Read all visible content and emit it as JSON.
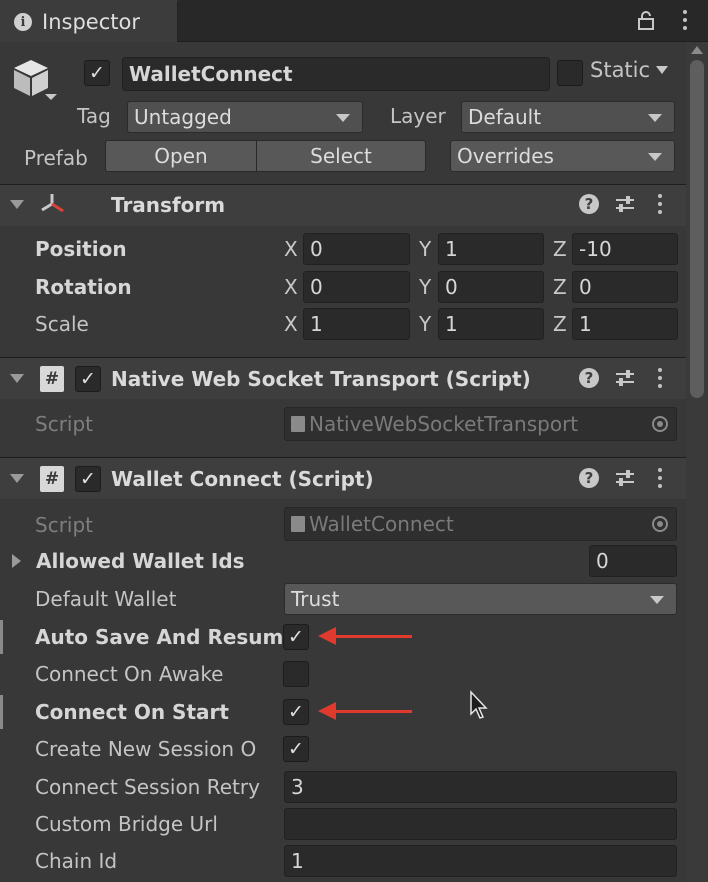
{
  "tab": {
    "title": "Inspector"
  },
  "header": {
    "name": "WalletConnect",
    "static_label": "Static",
    "tag_label": "Tag",
    "tag_value": "Untagged",
    "layer_label": "Layer",
    "layer_value": "Default",
    "prefab_label": "Prefab",
    "open_label": "Open",
    "select_label": "Select",
    "overrides_label": "Overrides"
  },
  "transform": {
    "title": "Transform",
    "rows": [
      {
        "label": "Position",
        "x": "0",
        "y": "1",
        "z": "-10"
      },
      {
        "label": "Rotation",
        "x": "0",
        "y": "0",
        "z": "0"
      },
      {
        "label": "Scale",
        "x": "1",
        "y": "1",
        "z": "1"
      }
    ],
    "axes": {
      "x": "X",
      "y": "Y",
      "z": "Z"
    }
  },
  "native": {
    "title": "Native Web Socket Transport (Script)",
    "script_label": "Script",
    "script_value": "NativeWebSocketTransport"
  },
  "wallet": {
    "title": "Wallet Connect (Script)",
    "script_label": "Script",
    "script_value": "WalletConnect",
    "allowed_label": "Allowed Wallet Ids",
    "allowed_count": "0",
    "default_wallet_label": "Default Wallet",
    "default_wallet_value": "Trust",
    "auto_save_label": "Auto Save And Resum",
    "connect_awake_label": "Connect On Awake",
    "connect_start_label": "Connect On Start",
    "create_session_label": "Create New Session O",
    "retry_label": "Connect Session Retry",
    "retry_value": "3",
    "bridge_label": "Custom Bridge Url",
    "bridge_value": "",
    "chain_label": "Chain Id",
    "chain_value": "1"
  },
  "icons": {
    "info": "info-icon",
    "lock": "lock-icon",
    "menu": "kebab-menu-icon",
    "gameobject": "cube-icon",
    "transform": "transform-axes-icon",
    "script": "script-hash-icon",
    "help": "help-icon",
    "presets": "presets-sliders-icon",
    "target": "object-picker-icon",
    "cursor": "mouse-cursor-icon"
  },
  "colors": {
    "background": "#383838",
    "annotation_arrow": "#e0392e"
  }
}
